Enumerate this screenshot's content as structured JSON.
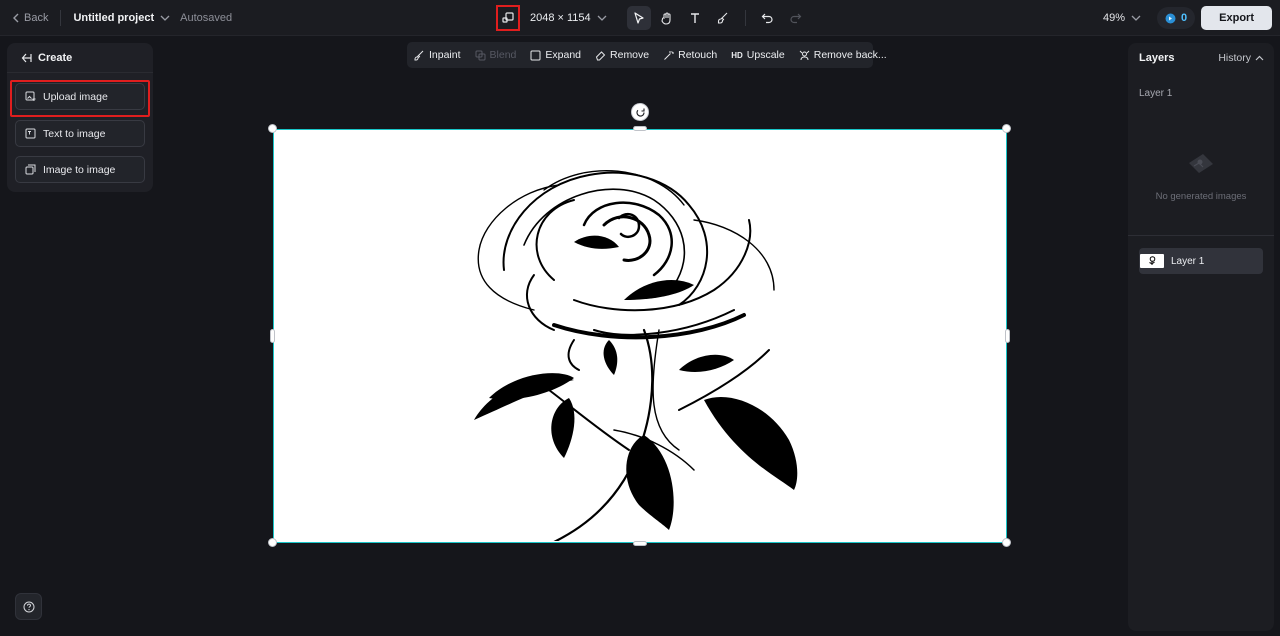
{
  "topbar": {
    "back_label": "Back",
    "project_name": "Untitled project",
    "autosave_status": "Autosaved",
    "dimensions": "2048 × 1154",
    "zoom": "49%",
    "credits": "0",
    "export_label": "Export"
  },
  "create_panel": {
    "title": "Create",
    "items": [
      {
        "label": "Upload image",
        "icon": "upload-image-icon"
      },
      {
        "label": "Text to image",
        "icon": "text-to-image-icon"
      },
      {
        "label": "Image to image",
        "icon": "image-to-image-icon"
      }
    ]
  },
  "edit_toolbar": {
    "items": [
      {
        "label": "Inpaint",
        "icon": "inpaint-icon",
        "enabled": true
      },
      {
        "label": "Blend",
        "icon": "blend-icon",
        "enabled": false
      },
      {
        "label": "Expand",
        "icon": "expand-icon",
        "enabled": true
      },
      {
        "label": "Remove",
        "icon": "eraser-icon",
        "enabled": true
      },
      {
        "label": "Retouch",
        "icon": "retouch-icon",
        "enabled": true
      },
      {
        "label": "Upscale",
        "icon": "hd-icon",
        "badge": "HD",
        "enabled": true
      },
      {
        "label": "Remove back...",
        "icon": "remove-background-icon",
        "enabled": true
      }
    ]
  },
  "layers_panel": {
    "title": "Layers",
    "history_label": "History",
    "current_layer_label": "Layer 1",
    "empty_text": "No generated images",
    "layers": [
      {
        "name": "Layer 1"
      }
    ]
  },
  "colors": {
    "accent_selection": "#19c6c9",
    "highlight_red": "#e01e1e",
    "credits_blue": "#4fc0ff"
  }
}
